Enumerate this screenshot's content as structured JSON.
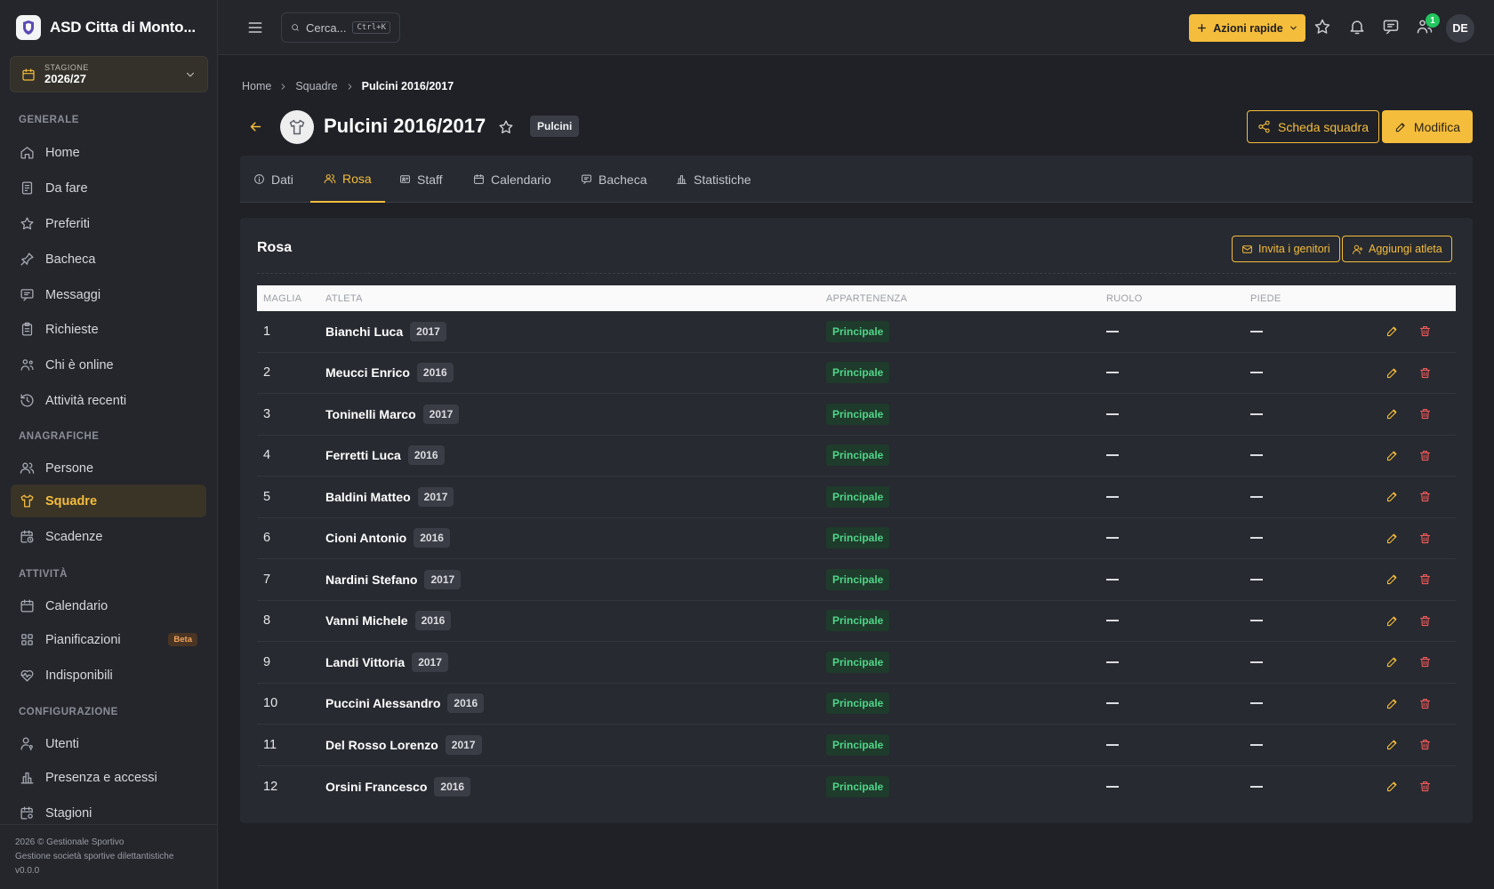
{
  "brand": {
    "name": "ASD Citta di Monto..."
  },
  "season": {
    "label": "STAGIONE",
    "value": "2026/27"
  },
  "nav": {
    "sections": [
      "GENERALE",
      "ANAGRAFICHE",
      "ATTIVITÀ",
      "CONFIGURAZIONE"
    ],
    "generale": [
      {
        "label": "Home",
        "icon": "home-icon"
      },
      {
        "label": "Da fare",
        "icon": "clipboard-icon"
      },
      {
        "label": "Preferiti",
        "icon": "star-icon"
      },
      {
        "label": "Bacheca",
        "icon": "pin-icon"
      },
      {
        "label": "Messaggi",
        "icon": "message-icon"
      },
      {
        "label": "Richieste",
        "icon": "clipboard-list-icon"
      },
      {
        "label": "Chi è online",
        "icon": "users-online-icon"
      },
      {
        "label": "Attività recenti",
        "icon": "history-icon"
      }
    ],
    "anagrafiche": [
      {
        "label": "Persone",
        "icon": "users-icon"
      },
      {
        "label": "Squadre",
        "icon": "shirt-icon"
      },
      {
        "label": "Scadenze",
        "icon": "calendar-clock-icon"
      }
    ],
    "attivita": [
      {
        "label": "Calendario",
        "icon": "calendar-icon"
      },
      {
        "label": "Pianificazioni",
        "icon": "grid-icon",
        "badge": "Beta"
      },
      {
        "label": "Indisponibili",
        "icon": "heart-pulse-icon"
      }
    ],
    "configurazione": [
      {
        "label": "Utenti",
        "icon": "user-key-icon"
      },
      {
        "label": "Presenza e accessi",
        "icon": "bar-chart-icon"
      },
      {
        "label": "Stagioni",
        "icon": "calendar-cog-icon"
      }
    ]
  },
  "footer": {
    "line1": "2026 © Gestionale Sportivo",
    "line2": "Gestione società sportive dilettantistiche",
    "line3": "v0.0.0"
  },
  "topbar": {
    "search_placeholder": "Cerca...",
    "search_kbd": "Ctrl+K",
    "quick_actions": "Azioni rapide",
    "online_count": "1",
    "avatar": "DE"
  },
  "breadcrumb": [
    "Home",
    "Squadre",
    "Pulcini 2016/2017"
  ],
  "page": {
    "title": "Pulcini 2016/2017",
    "category": "Pulcini",
    "btn_share": "Scheda squadra",
    "btn_edit": "Modifica"
  },
  "tabs": [
    {
      "label": "Dati",
      "icon": "info-icon"
    },
    {
      "label": "Rosa",
      "icon": "users-icon"
    },
    {
      "label": "Staff",
      "icon": "id-card-icon"
    },
    {
      "label": "Calendario",
      "icon": "calendar-icon"
    },
    {
      "label": "Bacheca",
      "icon": "message-icon"
    },
    {
      "label": "Statistiche",
      "icon": "bar-chart-icon"
    }
  ],
  "roster": {
    "title": "Rosa",
    "btn_invite": "Invita i genitori",
    "btn_add": "Aggiungi atleta",
    "columns": [
      "MAGLIA",
      "ATLETA",
      "APPARTENENZA",
      "RUOLO",
      "PIEDE"
    ],
    "rows": [
      {
        "num": "1",
        "name": "Bianchi Luca",
        "year": "2017",
        "membership": "Principale"
      },
      {
        "num": "2",
        "name": "Meucci Enrico",
        "year": "2016",
        "membership": "Principale"
      },
      {
        "num": "3",
        "name": "Toninelli Marco",
        "year": "2017",
        "membership": "Principale"
      },
      {
        "num": "4",
        "name": "Ferretti Luca",
        "year": "2016",
        "membership": "Principale"
      },
      {
        "num": "5",
        "name": "Baldini Matteo",
        "year": "2017",
        "membership": "Principale"
      },
      {
        "num": "6",
        "name": "Cioni Antonio",
        "year": "2016",
        "membership": "Principale"
      },
      {
        "num": "7",
        "name": "Nardini Stefano",
        "year": "2017",
        "membership": "Principale"
      },
      {
        "num": "8",
        "name": "Vanni Michele",
        "year": "2016",
        "membership": "Principale"
      },
      {
        "num": "9",
        "name": "Landi Vittoria",
        "year": "2017",
        "membership": "Principale"
      },
      {
        "num": "10",
        "name": "Puccini Alessandro",
        "year": "2016",
        "membership": "Principale"
      },
      {
        "num": "11",
        "name": "Del Rosso Lorenzo",
        "year": "2017",
        "membership": "Principale"
      },
      {
        "num": "12",
        "name": "Orsini Francesco",
        "year": "2016",
        "membership": "Principale"
      }
    ]
  },
  "colors": {
    "accent": "#f5bd3c",
    "success": "#52d58a",
    "danger": "#ef5a5a",
    "background": "#1f2127"
  }
}
